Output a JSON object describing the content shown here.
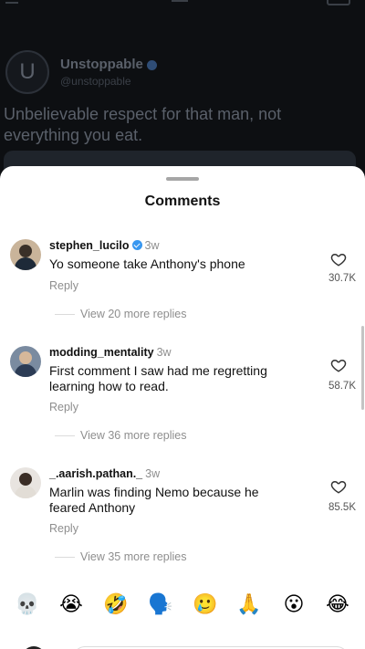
{
  "background_post": {
    "avatar_letter": "U",
    "author": "Unstoppable",
    "handle": "@unstoppable",
    "text": "Unbelievable respect for that man, not everything you eat."
  },
  "sheet": {
    "title": "Comments"
  },
  "comments": [
    {
      "username": "stephen_lucilo",
      "verified": true,
      "time": "3w",
      "text": "Yo someone take Anthony's phone",
      "reply_label": "Reply",
      "likes": "30.7K",
      "view_replies": "View 20 more replies"
    },
    {
      "username": "modding_mentality",
      "verified": false,
      "time": "3w",
      "text": "First comment I saw had me regretting learning how to read.",
      "reply_label": "Reply",
      "likes": "58.7K",
      "view_replies": "View 36 more replies"
    },
    {
      "username": "_.aarish.pathan._",
      "verified": false,
      "time": "3w",
      "text": "Marlin was finding Nemo because he feared Anthony",
      "reply_label": "Reply",
      "likes": "85.5K",
      "view_replies": "View 35 more replies"
    }
  ],
  "emoji_bar": [
    "💀",
    "😭",
    "🤣",
    "🗣️",
    "🥲",
    "🙏",
    "😮",
    "😂"
  ],
  "colors": {
    "verified_blue": "#3897f0",
    "overlay_dark": "#0d0f12",
    "secondary_text": "#8e8e8e"
  }
}
